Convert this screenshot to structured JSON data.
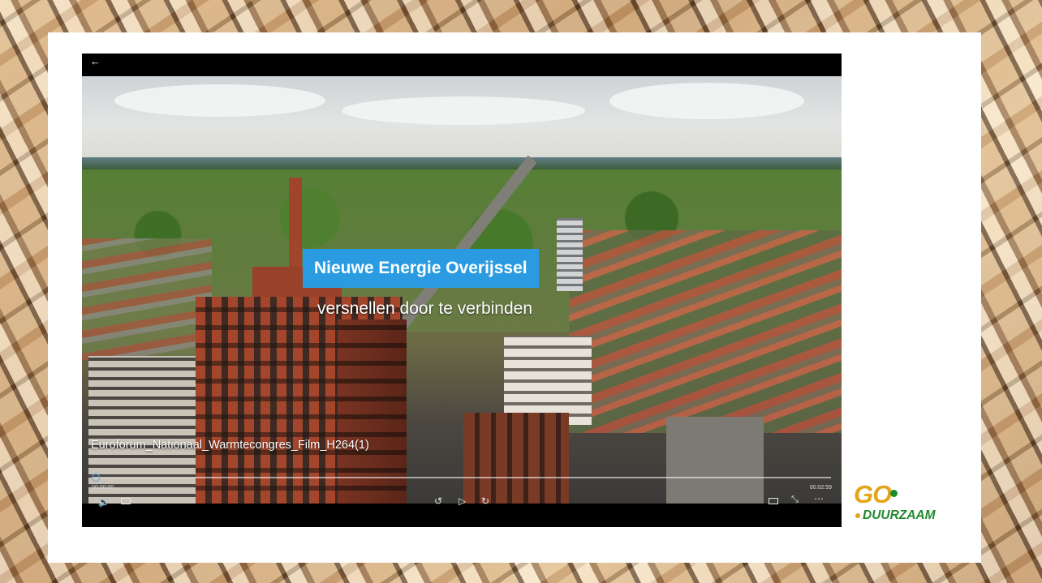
{
  "player": {
    "back_icon": "←",
    "overlay_title": "Nieuwe Energie Overijssel",
    "overlay_subtitle": "versnellen door te verbinden",
    "file_name": "Euroforum_Nationaal_Warmtecongres_Film_H264(1)",
    "time_elapsed": "00:00:00",
    "time_total": "00:02:59",
    "progress": 0.0,
    "controls": {
      "volume_icon": "volume-icon",
      "subtitles_icon": "subtitles-icon",
      "rewind_icon": "rewind-icon",
      "play_icon": "play-icon",
      "forward_icon": "forward-icon",
      "miniview_icon": "mini-view-icon",
      "fullscreen_icon": "exit-fullscreen-icon",
      "more_icon": "more-icon"
    }
  },
  "logo": {
    "top": "GO",
    "bottom": "DUURZAAM"
  },
  "colors": {
    "overlay_title_bg": "#2a9be0",
    "logo_orange": "#e4a51a",
    "logo_green": "#23892f"
  }
}
